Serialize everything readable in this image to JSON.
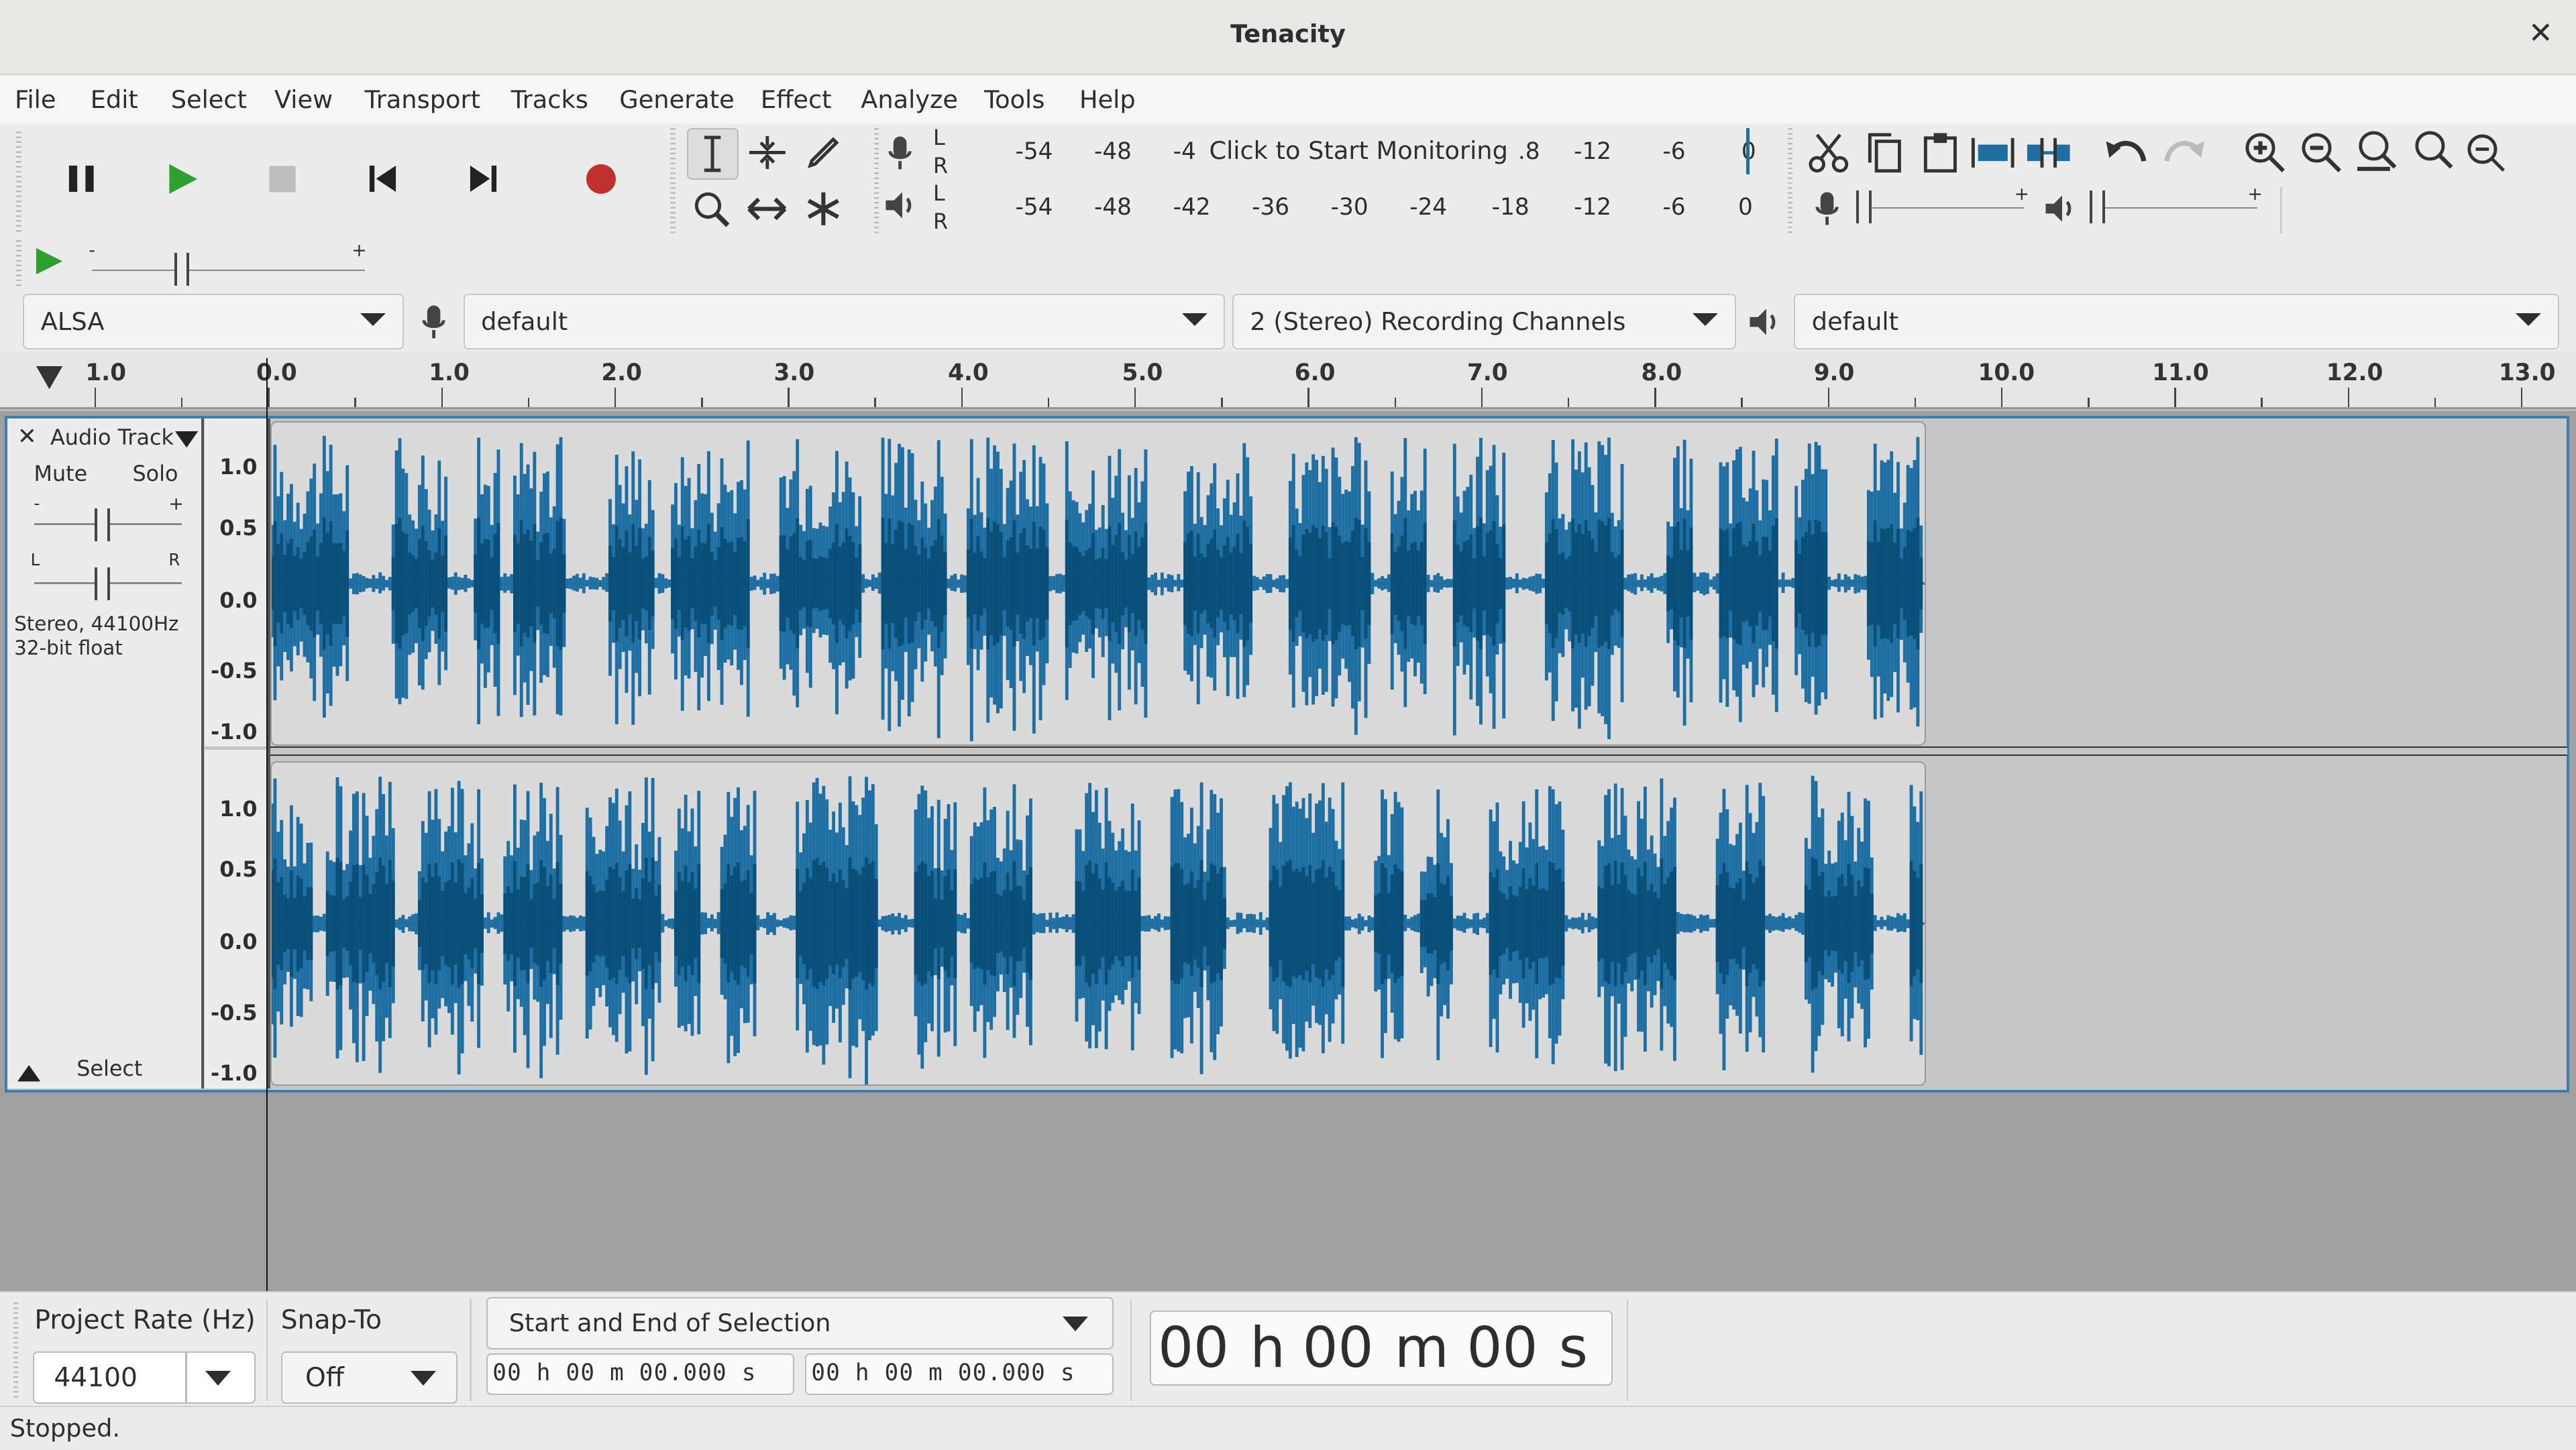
{
  "window": {
    "title": "Tenacity"
  },
  "menu": [
    "File",
    "Edit",
    "Select",
    "View",
    "Transport",
    "Tracks",
    "Generate",
    "Effect",
    "Analyze",
    "Tools",
    "Help"
  ],
  "meters": {
    "record_left": [
      "-54",
      "-48",
      "-4"
    ],
    "record_prompt": "Click to Start Monitoring",
    "record_right": [
      ".8",
      "-12",
      "-6",
      "0"
    ],
    "playback": [
      "-54",
      "-48",
      "-42",
      "-36",
      "-30",
      "-24",
      "-18",
      "-12",
      "-6",
      "0"
    ],
    "L": "L",
    "R": "R"
  },
  "device": {
    "host": "ALSA",
    "recording_device": "default",
    "channels": "2 (Stereo) Recording Channels",
    "playback_device": "default"
  },
  "ruler": {
    "labels": [
      "1.0",
      "0.0",
      "1.0",
      "2.0",
      "3.0",
      "4.0",
      "5.0",
      "6.0",
      "7.0",
      "8.0",
      "9.0",
      "10.0",
      "11.0",
      "12.0",
      "13.0"
    ]
  },
  "track": {
    "name": "Audio Track",
    "mute": "Mute",
    "solo": "Solo",
    "gain_minus": "-",
    "gain_plus": "+",
    "pan_left": "L",
    "pan_right": "R",
    "info_line1": "Stereo, 44100Hz",
    "info_line2": "32-bit float",
    "select": "Select",
    "scale": [
      "1.0",
      "0.5",
      "0.0",
      "-0.5",
      "-1.0"
    ]
  },
  "selection": {
    "project_rate_label": "Project Rate (Hz)",
    "project_rate": "44100",
    "snap_label": "Snap-To",
    "snap_value": "Off",
    "selection_mode": "Start and End of Selection",
    "start_time": "00 h 00 m 00.000 s",
    "end_time": "00 h 00 m 00.000 s",
    "big_h": "00",
    "big_h_unit": "h",
    "big_m": "00",
    "big_m_unit": "m",
    "big_s": "00",
    "big_s_unit": "s"
  },
  "status": "Stopped.",
  "colors": {
    "waveform": "#1f6fa3",
    "waveform_dark": "#0a4f7a",
    "track_border": "#3a7fb0",
    "record": "#c0302f",
    "play": "#2ea02e"
  }
}
